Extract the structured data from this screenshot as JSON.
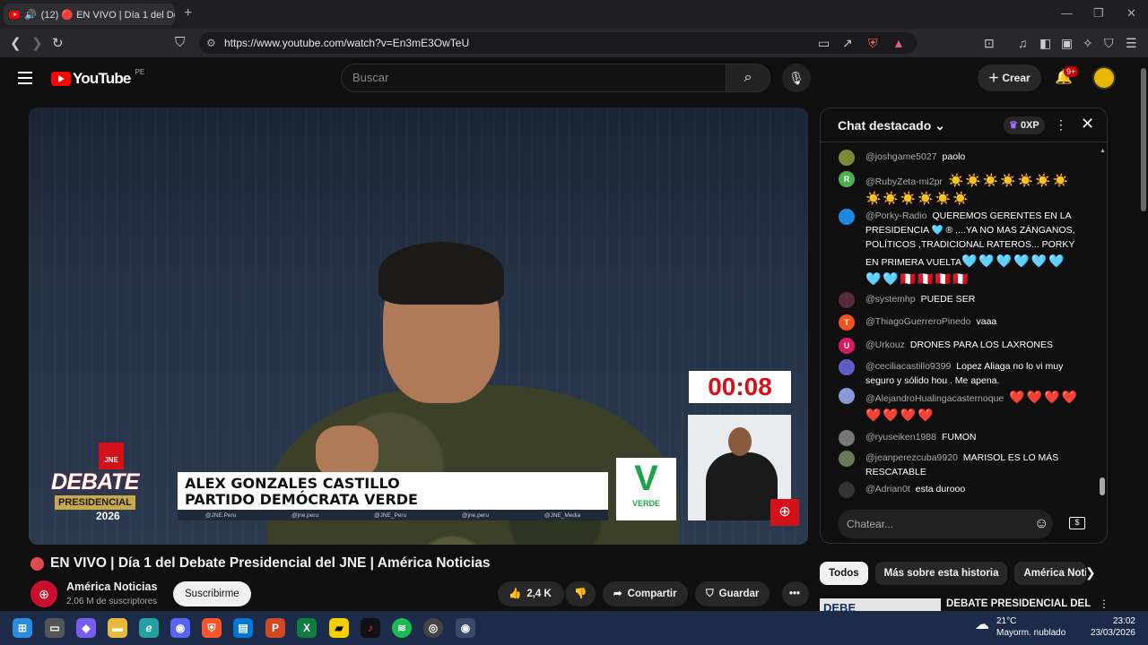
{
  "browser": {
    "tab_title": "(12) 🔴 EN VIVO | Día 1 del De",
    "tab_prefix": "🔊",
    "url": "https://www.youtube.com/watch?v=En3mE3OwTeU"
  },
  "header": {
    "logo_text": "YouTube",
    "country": "PE",
    "search_placeholder": "Buscar",
    "create_label": "Crear",
    "notif_badge": "9+"
  },
  "video": {
    "timer": "00:08",
    "speaker_name": "ALEX GONZALES CASTILLO",
    "speaker_party": "PARTIDO DEMÓCRATA VERDE",
    "debate_word": "DEBATE",
    "debate_sub": "PRESIDENCIAL",
    "debate_year": "2026",
    "jne": "JNE",
    "party_logo_letter": "V",
    "party_logo_text": "VERDE",
    "socials": [
      "@JNE.Peru",
      "@jne.peru",
      "@JNE_Peru",
      "@jne.peru",
      "@JNE_Media"
    ]
  },
  "chat": {
    "title": "Chat destacado",
    "xp": "0XP",
    "input_placeholder": "Chatear...",
    "messages": [
      {
        "user": "@joshgame5027",
        "text": "paolo",
        "emoji": "",
        "avatar_letter": "",
        "avatar_color": "#7a8a3a"
      },
      {
        "user": "@RubyZeta-mi2pr",
        "text": "",
        "emoji": "☀️☀️☀️☀️☀️☀️☀️☀️☀️☀️☀️☀️☀️",
        "avatar_letter": "R",
        "avatar_color": "#4caf50"
      },
      {
        "user": "@Porky-Radio",
        "text": "QUEREMOS GERENTES EN LA PRESIDENCIA 🩵 ® ,...YA NO MAS ZÁNGANOS, POLÍTICOS ,TRADICIONAL RATEROS... PORKY EN PRIMERA VUELTA",
        "emoji": "🩵🩵🩵🩵🩵🩵🩵🩵🇵🇪🇵🇪🇵🇪🇵🇪",
        "avatar_letter": "",
        "avatar_color": "#1e88e5"
      },
      {
        "user": "@systemhp",
        "text": "PUEDE SER",
        "emoji": "",
        "avatar_letter": "",
        "avatar_color": "#5a2a3a"
      },
      {
        "user": "@ThiagoGuerreroPinedo",
        "text": "vaaa",
        "emoji": "",
        "avatar_letter": "T",
        "avatar_color": "#f4511e"
      },
      {
        "user": "@Urkouz",
        "text": "DRONES PARA LOS LAXRONES",
        "emoji": "",
        "avatar_letter": "U",
        "avatar_color": "#d81b60"
      },
      {
        "user": "@ceciliacastillo9399",
        "text": "Lopez Aliaga no lo vi muy seguro y sólido hou . Me apena.",
        "emoji": "",
        "avatar_letter": "",
        "avatar_color": "#5e5ec8"
      },
      {
        "user": "@AlejandroHualingacasternoque",
        "text": "",
        "emoji": "❤️❤️❤️❤️❤️❤️❤️❤️",
        "avatar_letter": "",
        "avatar_color": "#8a9ad8"
      },
      {
        "user": "@ryuseiken1988",
        "text": "FUMON",
        "emoji": "",
        "avatar_letter": "",
        "avatar_color": "#777777"
      },
      {
        "user": "@jeanperezcuba9920",
        "text": "MARISOL ES LO MÁS RESCATABLE",
        "emoji": "",
        "avatar_letter": "",
        "avatar_color": "#6a7a5a"
      },
      {
        "user": "@Adrian0t",
        "text": "esta durooo",
        "emoji": "",
        "avatar_letter": "",
        "avatar_color": "#333333"
      }
    ]
  },
  "below": {
    "title": "EN VIVO | Día 1 del Debate Presidencial del JNE | América Noticias",
    "channel": "América Noticias",
    "subscribers": "2,06 M de suscriptores",
    "subscribe_label": "Suscribirme",
    "likes": "2,4 K",
    "share_label": "Compartir",
    "save_label": "Guardar"
  },
  "related": {
    "chips": [
      "Todos",
      "Más sobre esta historia",
      "América Noti"
    ],
    "first_title": "DEBATE PRESIDENCIAL DEL",
    "thumb_text": "DEBE"
  },
  "taskbar": {
    "temp": "21°C",
    "weather": "Mayorm. nublado",
    "time": "23:02",
    "date": "23/03/2026"
  },
  "colors": {
    "yt_red": "#ff0000",
    "timer_red": "#d4111b",
    "party_green": "#1aa34a",
    "background": "#0f0f0f"
  }
}
